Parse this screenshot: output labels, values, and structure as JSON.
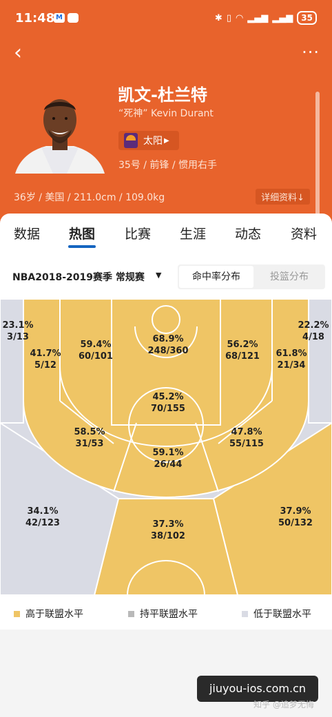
{
  "status_bar": {
    "time": "11:48",
    "battery": "35"
  },
  "colors": {
    "header_bg": "#e8632c",
    "above": "#efc565",
    "average": "#b9b9b9",
    "below": "#d9dbe4",
    "accent": "#1565c0"
  },
  "player": {
    "name": "凯文-杜兰特",
    "nickname": "“死神” Kevin Durant",
    "team": "太阳",
    "meta": "35号 / 前锋 / 惯用右手",
    "bio": "36岁 / 美国 / 211.0cm / 109.0kg",
    "detail_link": "详细资料↓"
  },
  "tabs": [
    "数据",
    "热图",
    "比赛",
    "生涯",
    "动态",
    "资料"
  ],
  "active_tab": "热图",
  "filter": {
    "season": "NBA2018-2019赛季 常规赛",
    "seg_active": "命中率分布",
    "seg_inactive": "投篮分布"
  },
  "zones": [
    {
      "name": "left-corner-3",
      "pct": "23.1%",
      "made": "3/13",
      "level": "below"
    },
    {
      "name": "right-corner-3",
      "pct": "22.2%",
      "made": "4/18",
      "level": "below"
    },
    {
      "name": "left-baseline-mid",
      "pct": "41.7%",
      "made": "5/12",
      "level": "above"
    },
    {
      "name": "left-elbow-mid",
      "pct": "59.4%",
      "made": "60/101",
      "level": "above"
    },
    {
      "name": "restricted-area",
      "pct": "68.9%",
      "made": "248/360",
      "level": "above"
    },
    {
      "name": "right-elbow-mid",
      "pct": "56.2%",
      "made": "68/121",
      "level": "above"
    },
    {
      "name": "right-baseline-mid",
      "pct": "61.8%",
      "made": "21/34",
      "level": "above"
    },
    {
      "name": "paint",
      "pct": "45.2%",
      "made": "70/155",
      "level": "above"
    },
    {
      "name": "left-wing-mid",
      "pct": "58.5%",
      "made": "31/53",
      "level": "above"
    },
    {
      "name": "right-wing-mid",
      "pct": "47.8%",
      "made": "55/115",
      "level": "above"
    },
    {
      "name": "top-key-mid",
      "pct": "59.1%",
      "made": "26/44",
      "level": "above"
    },
    {
      "name": "left-wing-3",
      "pct": "34.1%",
      "made": "42/123",
      "level": "below"
    },
    {
      "name": "top-key-3",
      "pct": "37.3%",
      "made": "38/102",
      "level": "above"
    },
    {
      "name": "right-wing-3",
      "pct": "37.9%",
      "made": "50/132",
      "level": "above"
    }
  ],
  "legend": [
    "高于联盟水平",
    "持平联盟水平",
    "低于联盟水平"
  ],
  "watermark": {
    "site": "jiuyou-ios.com.cn",
    "author": "知乎 @追梦无悔"
  }
}
